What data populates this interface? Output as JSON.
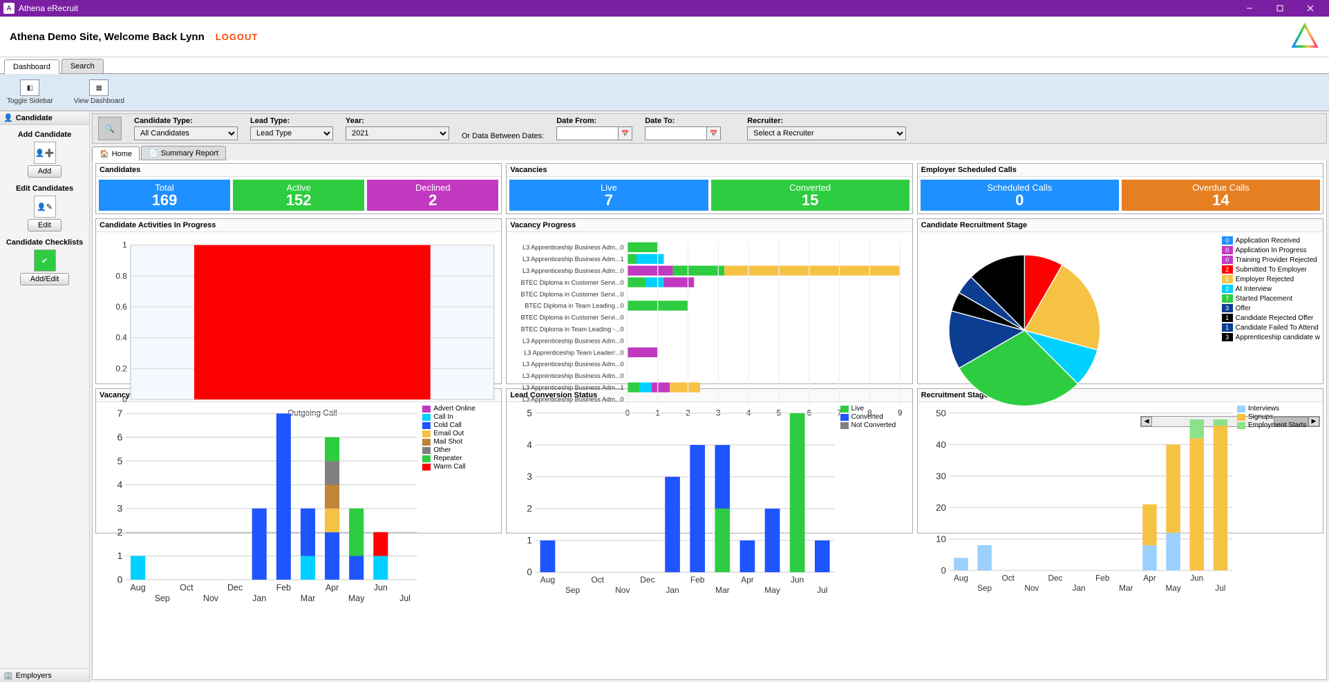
{
  "window": {
    "title": "Athena eRecruit"
  },
  "header": {
    "welcome": "Athena Demo Site,  Welcome Back Lynn",
    "logout": "LOGOUT"
  },
  "tabs": [
    "Dashboard",
    "Search"
  ],
  "ribbon": [
    {
      "label": "Toggle Sidebar"
    },
    {
      "label": "View Dashboard"
    }
  ],
  "sidebar": {
    "candidate_head": "Candidate",
    "add": {
      "title": "Add Candidate",
      "btn": "Add"
    },
    "edit": {
      "title": "Edit Candidates",
      "btn": "Edit"
    },
    "check": {
      "title": "Candidate Checklists",
      "btn": "Add/Edit"
    },
    "employers": "Employers"
  },
  "filters": {
    "candidate_type": {
      "label": "Candidate Type:",
      "value": "All Candidates"
    },
    "lead_type": {
      "label": "Lead Type:",
      "value": "Lead Type"
    },
    "year": {
      "label": "Year:",
      "value": "2021"
    },
    "between": "Or Data Between Dates:",
    "date_from": "Date From:",
    "date_to": "Date To:",
    "recruiter": {
      "label": "Recruiter:",
      "value": "Select a Recruiter"
    }
  },
  "subtabs": {
    "home": "Home",
    "summary": "Summary Report"
  },
  "kpi": {
    "candidates": {
      "title": "Candidates",
      "total": {
        "label": "Total",
        "value": "169",
        "color": "#1e90ff"
      },
      "active": {
        "label": "Active",
        "value": "152",
        "color": "#2ecc40"
      },
      "declined": {
        "label": "Declined",
        "value": "2",
        "color": "#c139c1"
      }
    },
    "vacancies": {
      "title": "Vacancies",
      "live": {
        "label": "Live",
        "value": "7",
        "color": "#1e90ff"
      },
      "converted": {
        "label": "Converted",
        "value": "15",
        "color": "#2ecc40"
      }
    },
    "calls": {
      "title": "Employer Scheduled Calls",
      "scheduled": {
        "label": "Scheduled Calls",
        "value": "0",
        "color": "#1e90ff"
      },
      "overdue": {
        "label": "Overdue Calls",
        "value": "14",
        "color": "#e67e22"
      }
    }
  },
  "panels": {
    "activities": "Candidate Activities In Progress",
    "vacprog": "Vacancy Progress",
    "recruitstage": "Candidate Recruitment Stage",
    "leadsrc": "Vacancy Lead Sources",
    "leadconv": "Lead Conversion Status",
    "stagebymonth": "Recruitment Stage By Month"
  },
  "chart_data": [
    {
      "id": "activities",
      "type": "bar",
      "categories": [
        "Outgoing Call"
      ],
      "values": [
        1
      ],
      "ylim": [
        0,
        1
      ],
      "yticks": [
        0,
        0.2,
        0.4,
        0.6,
        0.8,
        1
      ],
      "color": "#ff0000"
    },
    {
      "id": "vacancy_progress",
      "type": "bar-horizontal-stacked",
      "xlim": [
        0,
        9
      ],
      "xticks": [
        0,
        1,
        2,
        3,
        4,
        5,
        6,
        7,
        8,
        9
      ],
      "categories": [
        "L3 Apprenticeship Business Adm...0",
        "L3 Apprenticeship Business Adm...1",
        "L3 Apprenticeship Business Adm...0",
        "BTEC Diploma in Customer Servi...0",
        "BTEC Diploma in Customer Servi...0",
        "BTEC Diploma in Team Leading...0",
        "BTEC Diploma in Customer Servi...0",
        "BTEC Diploma in Team Leading -...0",
        "L3 Apprenticeship Business Adm...0",
        "L3 Apprenticeship Team Leader/...0",
        "L3 Apprenticeship Business Adm...0",
        "L3 Apprenticeship Business Adm...0",
        "L3 Apprenticeship Business Adm...1",
        "L3 Apprenticeship Business Adm...0"
      ],
      "series_colors": [
        "#2ecc40",
        "#00d0ff",
        "#c139c1",
        "#f5c244"
      ],
      "rows": [
        [
          [
            0,
            1,
            "#2ecc40"
          ]
        ],
        [
          [
            0,
            0.3,
            "#2ecc40"
          ],
          [
            0.3,
            1.2,
            "#00d0ff"
          ]
        ],
        [
          [
            0,
            1.5,
            "#c139c1"
          ],
          [
            1.5,
            3.2,
            "#2ecc40"
          ],
          [
            3.2,
            9,
            "#f5c244"
          ]
        ],
        [
          [
            0,
            0.6,
            "#2ecc40"
          ],
          [
            0.6,
            1.2,
            "#00d0ff"
          ],
          [
            1.2,
            2.2,
            "#c139c1"
          ]
        ],
        [],
        [
          [
            0,
            2,
            "#2ecc40"
          ]
        ],
        [],
        [],
        [],
        [
          [
            0,
            1,
            "#c139c1"
          ]
        ],
        [],
        [],
        [
          [
            0,
            0.4,
            "#2ecc40"
          ],
          [
            0.4,
            0.8,
            "#00d0ff"
          ],
          [
            0.8,
            1.4,
            "#c139c1"
          ],
          [
            1.4,
            2.4,
            "#f5c244"
          ]
        ],
        []
      ]
    },
    {
      "id": "recruit_stage",
      "type": "pie",
      "slices": [
        {
          "label": "Application Received",
          "value": 0,
          "color": "#1e90ff"
        },
        {
          "label": "Application In Progress",
          "value": 0,
          "color": "#c139c1"
        },
        {
          "label": "Training Provider Rejected",
          "value": 0,
          "color": "#c139c1"
        },
        {
          "label": "Submitted To Employer",
          "value": 2,
          "color": "#ff0000"
        },
        {
          "label": "Employer Rejected",
          "value": 5,
          "color": "#f5c244"
        },
        {
          "label": "At Interview",
          "value": 2,
          "color": "#00d0ff"
        },
        {
          "label": "Started Placement",
          "value": 7,
          "color": "#2ecc40"
        },
        {
          "label": "Offer",
          "value": 3,
          "color": "#0b3d91"
        },
        {
          "label": "Candidate Rejected Offer",
          "value": 1,
          "color": "#000000"
        },
        {
          "label": "Candidate Failed To Attend",
          "value": 1,
          "color": "#0b3d91"
        },
        {
          "label": "Apprenticeship candidate w",
          "value": 3,
          "color": "#000000"
        }
      ]
    },
    {
      "id": "lead_sources",
      "type": "bar-stacked",
      "categories": [
        "Aug",
        "Sep",
        "Oct",
        "Nov",
        "Dec",
        "Jan",
        "Feb",
        "Mar",
        "Apr",
        "May",
        "Jun",
        "Jul"
      ],
      "ylim": [
        0,
        7
      ],
      "yticks": [
        0,
        1,
        2,
        3,
        4,
        5,
        6,
        7
      ],
      "series": [
        {
          "name": "Advert Online",
          "color": "#c139c1",
          "values": [
            0,
            0,
            0,
            0,
            0,
            0,
            0,
            0,
            0,
            0,
            0,
            0
          ]
        },
        {
          "name": "Call In",
          "color": "#00d0ff",
          "values": [
            1,
            0,
            0,
            0,
            0,
            0,
            0,
            1,
            0,
            0,
            1,
            0
          ]
        },
        {
          "name": "Cold Call",
          "color": "#1e55ff",
          "values": [
            0,
            0,
            0,
            0,
            0,
            3,
            7,
            2,
            2,
            1,
            0,
            0
          ]
        },
        {
          "name": "Email Out",
          "color": "#f5c244",
          "values": [
            0,
            0,
            0,
            0,
            0,
            0,
            0,
            0,
            1,
            0,
            0,
            0
          ]
        },
        {
          "name": "Mail Shot",
          "color": "#c0843a",
          "values": [
            0,
            0,
            0,
            0,
            0,
            0,
            0,
            0,
            1,
            0,
            0,
            0
          ]
        },
        {
          "name": "Other",
          "color": "#808080",
          "values": [
            0,
            0,
            0,
            0,
            0,
            0,
            0,
            0,
            1,
            0,
            0,
            0
          ]
        },
        {
          "name": "Repeater",
          "color": "#2ecc40",
          "values": [
            0,
            0,
            0,
            0,
            0,
            0,
            0,
            0,
            1,
            2,
            0,
            0
          ]
        },
        {
          "name": "Warm Call",
          "color": "#ff0000",
          "values": [
            0,
            0,
            0,
            0,
            0,
            0,
            0,
            0,
            0,
            0,
            1,
            0
          ]
        }
      ]
    },
    {
      "id": "lead_conversion",
      "type": "bar-stacked",
      "categories": [
        "Aug",
        "Sep",
        "Oct",
        "Nov",
        "Dec",
        "Jan",
        "Feb",
        "Mar",
        "Apr",
        "May",
        "Jun",
        "Jul"
      ],
      "ylim": [
        0,
        5
      ],
      "yticks": [
        0,
        1,
        2,
        3,
        4,
        5
      ],
      "series": [
        {
          "name": "Live",
          "color": "#2ecc40",
          "values": [
            0,
            0,
            0,
            0,
            0,
            0,
            0,
            2,
            0,
            0,
            5,
            0
          ]
        },
        {
          "name": "Converted",
          "color": "#1e55ff",
          "values": [
            1,
            0,
            0,
            0,
            0,
            3,
            4,
            2,
            1,
            2,
            0,
            1
          ]
        },
        {
          "name": "Not Converted",
          "color": "#808080",
          "values": [
            0,
            0,
            0,
            0,
            0,
            0,
            0,
            0,
            0,
            0,
            0,
            0
          ]
        }
      ]
    },
    {
      "id": "stage_by_month",
      "type": "bar-stacked",
      "categories": [
        "Aug",
        "Sep",
        "Oct",
        "Nov",
        "Dec",
        "Jan",
        "Feb",
        "Mar",
        "Apr",
        "May",
        "Jun",
        "Jul"
      ],
      "ylim": [
        0,
        50
      ],
      "yticks": [
        0,
        10,
        20,
        30,
        40,
        50
      ],
      "series": [
        {
          "name": "Interviews",
          "color": "#9bd0ff",
          "values": [
            4,
            8,
            0,
            0,
            0,
            0,
            0,
            0,
            8,
            12,
            0,
            0
          ]
        },
        {
          "name": "Signups",
          "color": "#f5c244",
          "values": [
            0,
            0,
            0,
            0,
            0,
            0,
            0,
            0,
            13,
            28,
            42,
            46
          ]
        },
        {
          "name": "Employment Starts",
          "color": "#8be28b",
          "values": [
            0,
            0,
            0,
            0,
            0,
            0,
            0,
            0,
            0,
            0,
            6,
            2
          ]
        }
      ]
    }
  ]
}
